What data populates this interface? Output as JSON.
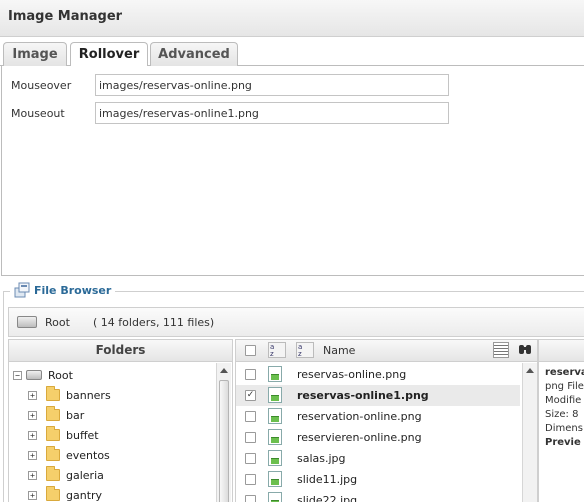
{
  "window": {
    "title": "Image Manager"
  },
  "tabs": [
    {
      "label": "Image",
      "active": false
    },
    {
      "label": "Rollover",
      "active": true
    },
    {
      "label": "Advanced",
      "active": false
    }
  ],
  "rollover": {
    "mouseover_label": "Mouseover",
    "mouseover_value": "images/reservas-online.png",
    "mouseout_label": "Mouseout",
    "mouseout_value": "images/reservas-online1.png"
  },
  "file_browser": {
    "legend": "File Browser",
    "path_root": "Root",
    "path_info": "( 14 folders, 111 files)",
    "folders_header": "Folders",
    "tree_root": "Root",
    "folders": [
      "banners",
      "bar",
      "buffet",
      "eventos",
      "galeria",
      "gantry"
    ],
    "files_header_name": "Name",
    "files": [
      {
        "name": "reservas-online.png",
        "selected": false,
        "checked": false
      },
      {
        "name": "reservas-online1.png",
        "selected": true,
        "checked": true
      },
      {
        "name": "reservation-online.png",
        "selected": false,
        "checked": false
      },
      {
        "name": "reservieren-online.png",
        "selected": false,
        "checked": false
      },
      {
        "name": "salas.jpg",
        "selected": false,
        "checked": false
      },
      {
        "name": "slide11.jpg",
        "selected": false,
        "checked": false
      },
      {
        "name": "slide22.jpg",
        "selected": false,
        "checked": false
      }
    ],
    "details": {
      "title": "reserva",
      "type": "png File",
      "modified": "Modifie",
      "size": "Size: 8",
      "dimensions": "Dimens",
      "preview": "Previe"
    }
  }
}
